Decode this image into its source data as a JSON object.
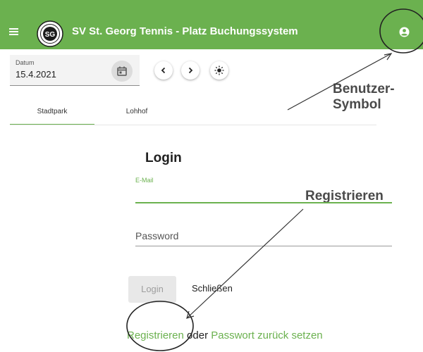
{
  "app": {
    "title": "SV St. Georg Tennis - Platz Buchungssystem",
    "logo_text": "SG",
    "accent": "#6bb14f"
  },
  "date_field": {
    "label": "Datum",
    "value": "15.4.2021"
  },
  "icons": {
    "menu": "menu-icon",
    "user": "user-icon",
    "calendar": "calendar-icon",
    "prev": "chevron-left-icon",
    "next": "chevron-right-icon",
    "theme": "sun-icon"
  },
  "tabs": [
    {
      "label": "Stadtpark",
      "active": true
    },
    {
      "label": "Lohhof",
      "active": false
    }
  ],
  "annotations": {
    "user_symbol_line1": "Benutzer-",
    "user_symbol_line2": "Symbol",
    "register": "Registrieren"
  },
  "login": {
    "title": "Login",
    "email_label": "E-Mail",
    "email_value": "",
    "password_placeholder": "Password",
    "login_button": "Login",
    "close_button": "Schließen",
    "register_link": "Registrieren",
    "or_text": "oder",
    "reset_link": "Passwort zurück setzen"
  }
}
